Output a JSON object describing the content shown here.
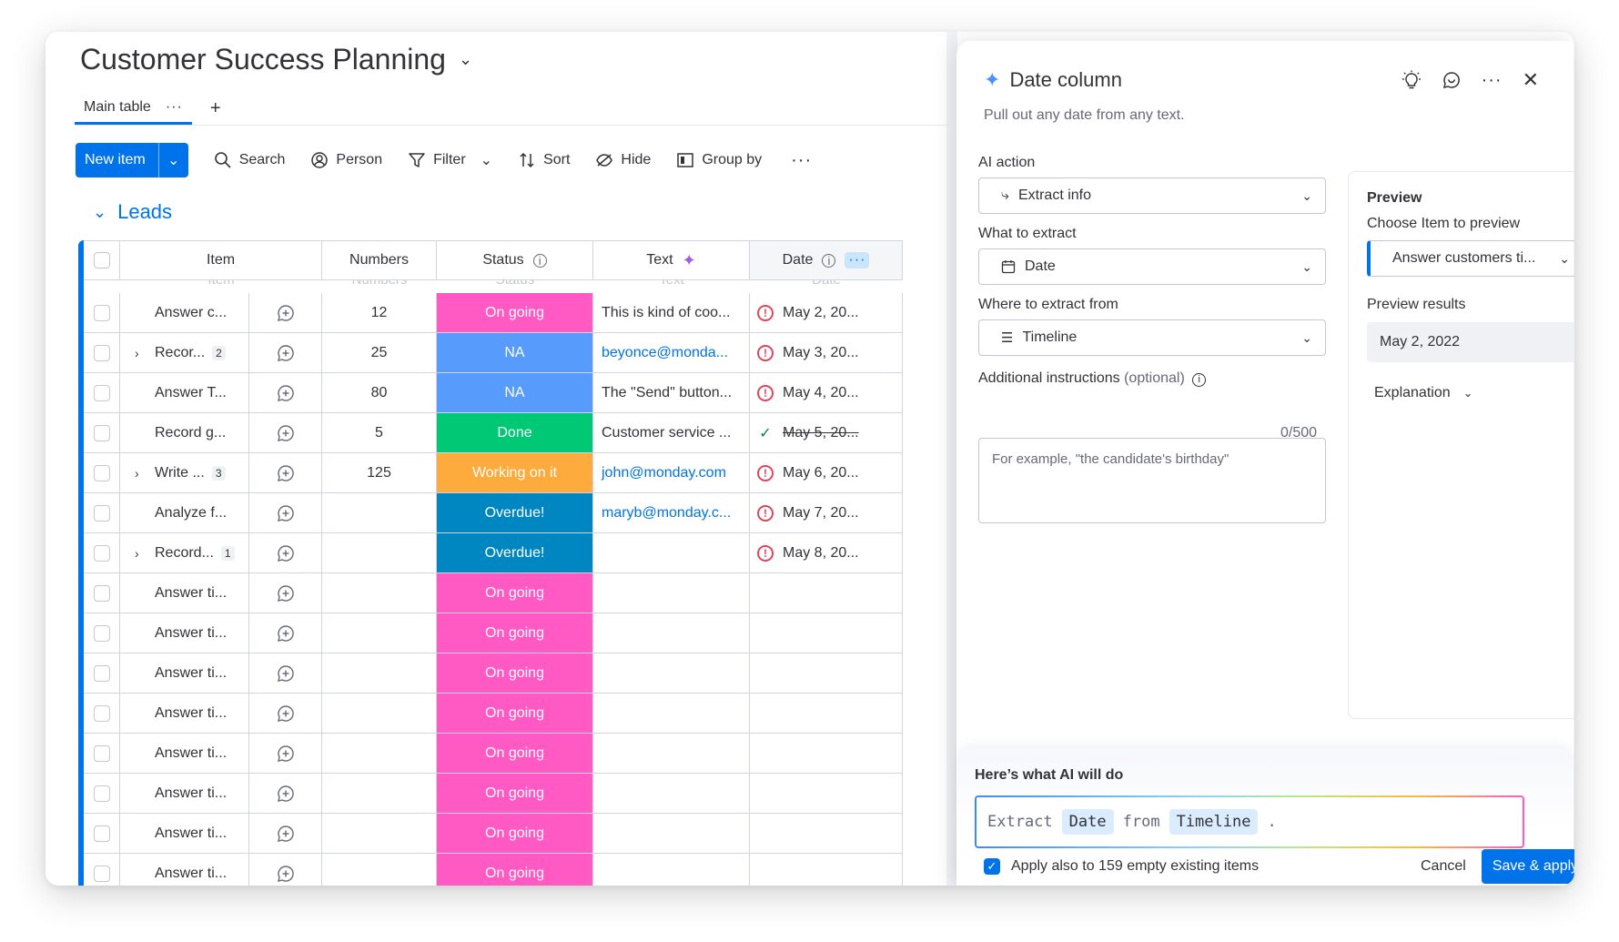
{
  "board": {
    "title": "Customer Success Planning"
  },
  "tabs": {
    "main": "Main table",
    "more": "···",
    "add": "+"
  },
  "toolbar": {
    "new_item": "New item",
    "search": "Search",
    "person": "Person",
    "filter": "Filter",
    "sort": "Sort",
    "hide": "Hide",
    "group_by": "Group by",
    "more": "···"
  },
  "group": {
    "title": "Leads",
    "color": "#0073ea"
  },
  "columns": {
    "item": "Item",
    "numbers": "Numbers",
    "status": "Status",
    "text": "Text",
    "date": "Date"
  },
  "rows": [
    {
      "item": "Answer c...",
      "expand": "",
      "sub": "",
      "number": "12",
      "status": "On going",
      "status_color": "#ff5ac4",
      "text": "This is kind of coo...",
      "text_link": false,
      "date": "May 2, 20...",
      "date_state": "alert"
    },
    {
      "item": "Recor...",
      "expand": "›",
      "sub": "2",
      "number": "25",
      "status": "NA",
      "status_color": "#579bfc",
      "text": "beyonce@monda...",
      "text_link": true,
      "date": "May 3, 20...",
      "date_state": "alert"
    },
    {
      "item": "Answer T...",
      "expand": "",
      "sub": "",
      "number": "80",
      "status": "NA",
      "status_color": "#579bfc",
      "text": "The \"Send\" button...",
      "text_link": false,
      "date": "May 4, 20...",
      "date_state": "alert"
    },
    {
      "item": "Record g...",
      "expand": "",
      "sub": "",
      "number": "5",
      "status": "Done",
      "status_color": "#00c875",
      "text": "Customer service ...",
      "text_link": false,
      "date": "May 5, 20...",
      "date_state": "done"
    },
    {
      "item": "Write ...",
      "expand": "›",
      "sub": "3",
      "number": "125",
      "status": "Working on it",
      "status_color": "#fdab3d",
      "text": "john@monday.com",
      "text_link": true,
      "date": "May 6, 20...",
      "date_state": "alert"
    },
    {
      "item": "Analyze f...",
      "expand": "",
      "sub": "",
      "number": "",
      "status": "Overdue!",
      "status_color": "#0086c0",
      "text": "maryb@monday.c...",
      "text_link": true,
      "date": "May 7, 20...",
      "date_state": "alert"
    },
    {
      "item": "Record...",
      "expand": "›",
      "sub": "1",
      "number": "",
      "status": "Overdue!",
      "status_color": "#0086c0",
      "text": "",
      "text_link": false,
      "date": "May 8, 20...",
      "date_state": "alert"
    },
    {
      "item": "Answer ti...",
      "expand": "",
      "sub": "",
      "number": "",
      "status": "On going",
      "status_color": "#ff5ac4",
      "text": "",
      "text_link": false,
      "date": "",
      "date_state": ""
    },
    {
      "item": "Answer ti...",
      "expand": "",
      "sub": "",
      "number": "",
      "status": "On going",
      "status_color": "#ff5ac4",
      "text": "",
      "text_link": false,
      "date": "",
      "date_state": ""
    },
    {
      "item": "Answer ti...",
      "expand": "",
      "sub": "",
      "number": "",
      "status": "On going",
      "status_color": "#ff5ac4",
      "text": "",
      "text_link": false,
      "date": "",
      "date_state": ""
    },
    {
      "item": "Answer ti...",
      "expand": "",
      "sub": "",
      "number": "",
      "status": "On going",
      "status_color": "#ff5ac4",
      "text": "",
      "text_link": false,
      "date": "",
      "date_state": ""
    },
    {
      "item": "Answer ti...",
      "expand": "",
      "sub": "",
      "number": "",
      "status": "On going",
      "status_color": "#ff5ac4",
      "text": "",
      "text_link": false,
      "date": "",
      "date_state": ""
    },
    {
      "item": "Answer ti...",
      "expand": "",
      "sub": "",
      "number": "",
      "status": "On going",
      "status_color": "#ff5ac4",
      "text": "",
      "text_link": false,
      "date": "",
      "date_state": ""
    },
    {
      "item": "Answer ti...",
      "expand": "",
      "sub": "",
      "number": "",
      "status": "On going",
      "status_color": "#ff5ac4",
      "text": "",
      "text_link": false,
      "date": "",
      "date_state": ""
    },
    {
      "item": "Answer ti...",
      "expand": "",
      "sub": "",
      "number": "",
      "status": "On going",
      "status_color": "#ff5ac4",
      "text": "",
      "text_link": false,
      "date": "",
      "date_state": ""
    }
  ],
  "panel": {
    "title": "Date column",
    "subtitle": "Pull out any date from any text.",
    "ai_action_label": "AI action",
    "ai_action_value": "Extract info",
    "what_label": "What to extract",
    "what_value": "Date",
    "where_label": "Where to extract from",
    "where_value": "Timeline",
    "instructions_label": "Additional instructions",
    "instructions_optional": "(optional)",
    "instructions_placeholder": "For example, \"the candidate's birthday\"",
    "instructions_counter": "0/500",
    "preview": {
      "title": "Preview",
      "choose_label": "Choose Item to preview",
      "choose_value": "Answer customers ti...",
      "results_label": "Preview results",
      "results_value": "May 2, 2022",
      "explanation": "Explanation"
    },
    "ai_summary": {
      "heading": "Here’s what AI will do",
      "word1": "Extract",
      "chip1": "Date",
      "word2": "from",
      "chip2": "Timeline",
      "end": "."
    },
    "apply_label": "Apply also to 159 empty existing items",
    "cancel": "Cancel",
    "save": "Save & apply"
  }
}
